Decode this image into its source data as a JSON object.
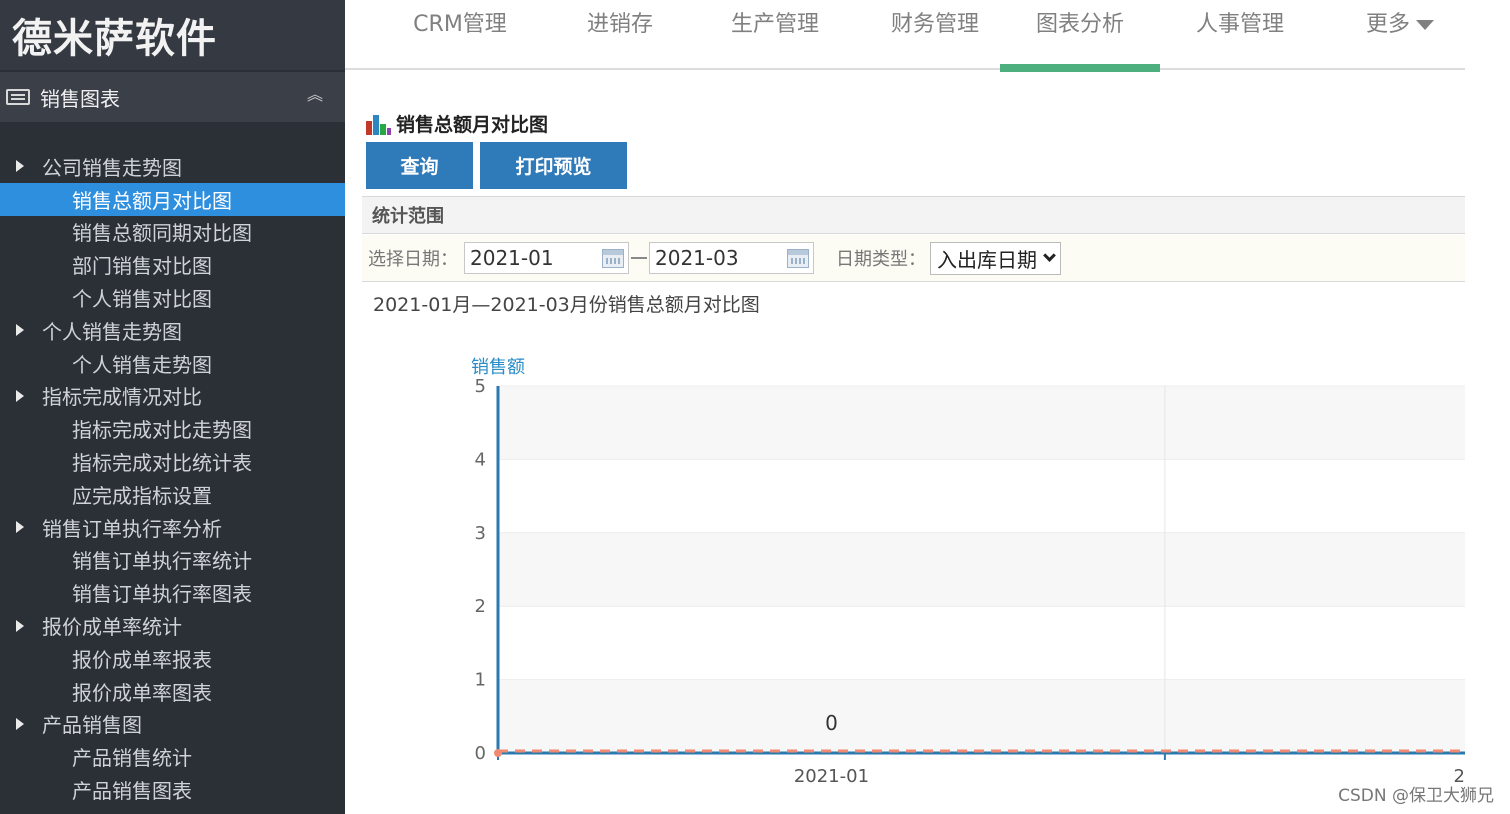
{
  "app": {
    "logo_text": "德米萨软件"
  },
  "topnav": {
    "tabs": [
      {
        "label": "CRM管理",
        "active": false
      },
      {
        "label": "进销存",
        "active": false
      },
      {
        "label": "生产管理",
        "active": false
      },
      {
        "label": "财务管理",
        "active": false
      },
      {
        "label": "图表分析",
        "active": true
      },
      {
        "label": "人事管理",
        "active": false
      },
      {
        "label": "更多",
        "active": false,
        "has_dropdown": true
      }
    ]
  },
  "sidebar": {
    "header": "销售图表",
    "collapse_icon": "double-chevron-up-icon",
    "menu": [
      {
        "type": "group",
        "label": "公司销售走势图"
      },
      {
        "type": "item",
        "label": "销售总额月对比图",
        "active": true
      },
      {
        "type": "item",
        "label": "销售总额同期对比图"
      },
      {
        "type": "item",
        "label": "部门销售对比图"
      },
      {
        "type": "item",
        "label": "个人销售对比图"
      },
      {
        "type": "group",
        "label": "个人销售走势图"
      },
      {
        "type": "item",
        "label": "个人销售走势图"
      },
      {
        "type": "group",
        "label": "指标完成情况对比"
      },
      {
        "type": "item",
        "label": "指标完成对比走势图"
      },
      {
        "type": "item",
        "label": "指标完成对比统计表"
      },
      {
        "type": "item",
        "label": "应完成指标设置"
      },
      {
        "type": "group",
        "label": "销售订单执行率分析"
      },
      {
        "type": "item",
        "label": "销售订单执行率统计"
      },
      {
        "type": "item",
        "label": "销售订单执行率图表"
      },
      {
        "type": "group",
        "label": "报价成单率统计"
      },
      {
        "type": "item",
        "label": "报价成单率报表"
      },
      {
        "type": "item",
        "label": "报价成单率图表"
      },
      {
        "type": "group",
        "label": "产品销售图"
      },
      {
        "type": "item",
        "label": "产品销售统计"
      },
      {
        "type": "item",
        "label": "产品销售图表"
      }
    ]
  },
  "main": {
    "panel_title": "销售总额月对比图",
    "buttons": {
      "query": "查询",
      "print_preview": "打印预览"
    },
    "range": {
      "header": "统计范围",
      "date_label": "选择日期：",
      "start_date": "2021-01",
      "end_date": "2021-03",
      "type_label": "日期类型：",
      "type_value": "入出库日期"
    },
    "chart_caption": "2021-01月—2021-03月份销售总额月对比图"
  },
  "chart_data": {
    "type": "line",
    "ylabel": "销售额",
    "ylim": [
      0,
      5
    ],
    "yticks": [
      0,
      1,
      2,
      3,
      4,
      5
    ],
    "categories": [
      "2021-01",
      "2"
    ],
    "series": [
      {
        "values": [
          0,
          0
        ],
        "data_labels": [
          "0"
        ]
      }
    ],
    "grid": true,
    "colors": {
      "axis": "#2a7ab0",
      "baseline_dash": "#f08a73",
      "band": "#f7f7f7",
      "ylabel": "#2a8bc9"
    }
  },
  "watermark": "CSDN @保卫大狮兄"
}
